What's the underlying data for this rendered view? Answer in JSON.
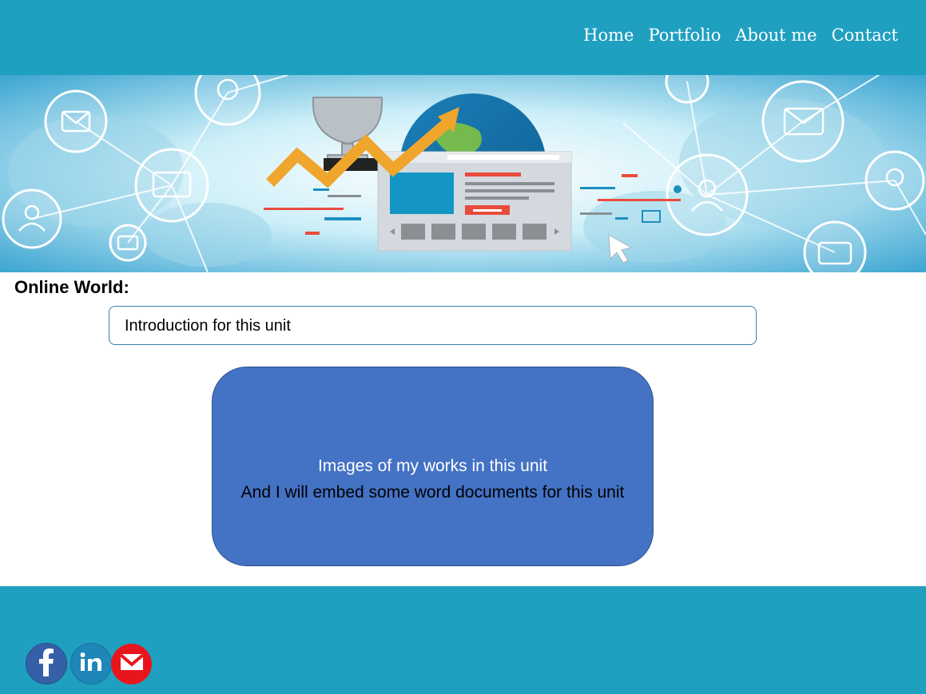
{
  "nav": {
    "items": [
      {
        "label": "Home"
      },
      {
        "label": "Portfolio"
      },
      {
        "label": "About me"
      },
      {
        "label": "Contact"
      }
    ]
  },
  "main": {
    "section_title": "Online World:",
    "intro": "Introduction for this unit",
    "works_line1": "Images of my works in this unit",
    "works_line2": "And I will embed some word documents for this unit"
  },
  "footer": {
    "social": [
      {
        "icon": "facebook-icon",
        "color": "#3560a8"
      },
      {
        "icon": "linkedin-icon",
        "color": "#1f86b8"
      },
      {
        "icon": "email-icon",
        "color": "#e8161c"
      }
    ]
  },
  "colors": {
    "header": "#1fa0c0",
    "footer": "#1fa0c0",
    "works_box": "#4472c4",
    "intro_border": "#3a7ea8"
  }
}
